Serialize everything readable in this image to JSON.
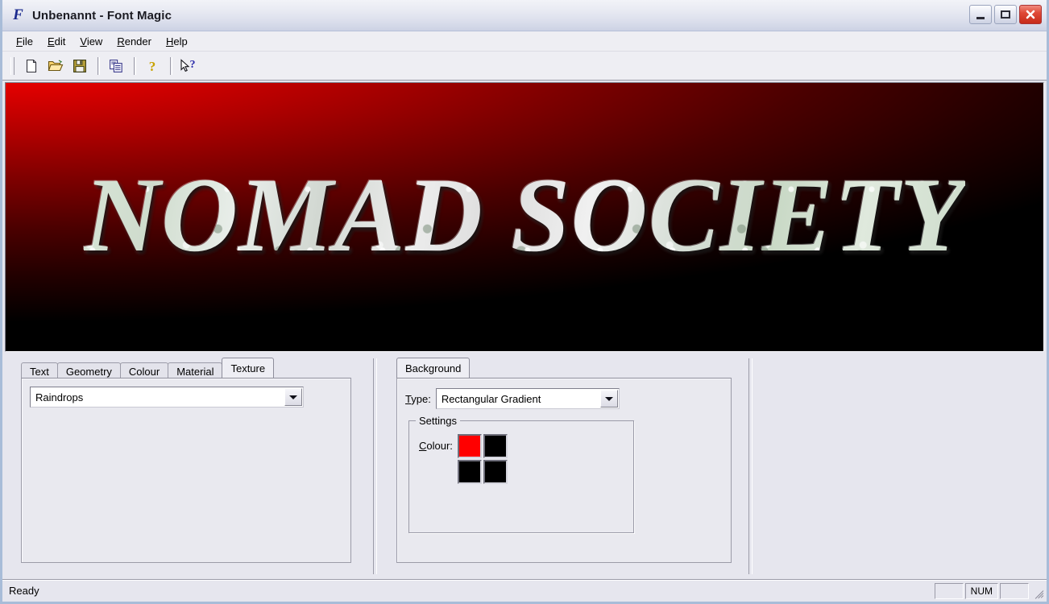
{
  "window": {
    "title": "Unbenannt - Font Magic",
    "app_icon": "font-magic-f-icon",
    "controls": {
      "minimize": "minimize-icon",
      "maximize": "maximize-icon",
      "close": "close-icon"
    }
  },
  "menubar": {
    "items": [
      {
        "label": "File",
        "accel": "F"
      },
      {
        "label": "Edit",
        "accel": "E"
      },
      {
        "label": "View",
        "accel": "V"
      },
      {
        "label": "Render",
        "accel": "R"
      },
      {
        "label": "Help",
        "accel": "H"
      }
    ]
  },
  "toolbar": {
    "buttons": [
      {
        "name": "new-icon",
        "tip": "New"
      },
      {
        "name": "open-folder-icon",
        "tip": "Open"
      },
      {
        "name": "save-floppy-icon",
        "tip": "Save"
      },
      {
        "name": "copy-icon",
        "tip": "Copy"
      },
      {
        "name": "help-question-icon",
        "tip": "Help"
      },
      {
        "name": "context-help-icon",
        "tip": "Context Help"
      }
    ]
  },
  "preview": {
    "render_text": "NOMAD SOCIETY",
    "background_start_color": "#ff0000",
    "background_end_color": "#000000",
    "texture_color": "#d7e4d6"
  },
  "left_panel": {
    "tabs": [
      {
        "label": "Text",
        "active": false
      },
      {
        "label": "Geometry",
        "active": false
      },
      {
        "label": "Colour",
        "active": false
      },
      {
        "label": "Material",
        "active": false
      },
      {
        "label": "Texture",
        "active": true
      }
    ],
    "texture_combo": {
      "value": "Raindrops",
      "placeholder": "Raindrops"
    }
  },
  "middle_panel": {
    "tabs": [
      {
        "label": "Background",
        "active": true
      }
    ],
    "type_label": "Type:",
    "type_label_accel": "T",
    "type_combo": {
      "value": "Rectangular Gradient",
      "placeholder": "Rectangular Gradient"
    },
    "settings_group": {
      "legend": "Settings",
      "colour_label": "Colour:",
      "colour_label_accel": "C",
      "swatches": [
        {
          "name": "swatch-top-left",
          "color": "#ff0000"
        },
        {
          "name": "swatch-top-right",
          "color": "#000000"
        },
        {
          "name": "swatch-bottom-left",
          "color": "#000000"
        },
        {
          "name": "swatch-bottom-right",
          "color": "#000000"
        }
      ]
    }
  },
  "statusbar": {
    "message": "Ready",
    "panes": [
      "",
      "NUM",
      ""
    ]
  }
}
